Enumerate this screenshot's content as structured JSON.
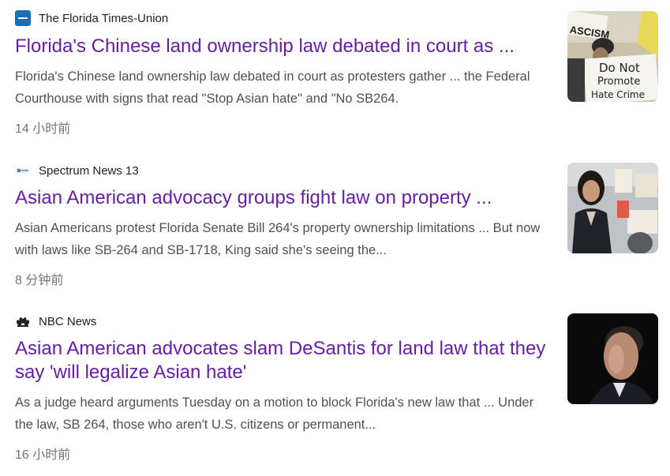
{
  "results": [
    {
      "source": "The Florida Times-Union",
      "source_icon": "times-union-logo-icon",
      "title": "Florida's Chinese land ownership law debated in court as ...",
      "snippet": "Florida's Chinese land ownership law debated in court as protesters gather ... the Federal Courthouse with signs that read \"Stop Asian hate\" and \"No SB264.",
      "time": "14 小时前",
      "thumbnail_signs": [
        "ASCISM",
        "Do Not",
        "Promote",
        "Hate Crime"
      ]
    },
    {
      "source": "Spectrum News 13",
      "source_icon": "spectrum-news-logo-icon",
      "title": "Asian American advocacy groups fight law on property ...",
      "snippet": "Asian Americans protest Florida Senate Bill 264's property ownership limitations ... But now with laws like SB-264 and SB-1718, King said she's seeing the...",
      "time": "8 分钟前"
    },
    {
      "source": "NBC News",
      "source_icon": "nbc-peacock-logo-icon",
      "title": "Asian American advocates slam DeSantis for land law that they say 'will legalize Asian hate'",
      "snippet": "As a judge heard arguments Tuesday on a motion to block Florida's new law that ... Under the law, SB 264, those who aren't U.S. citizens or permanent...",
      "time": "16 小时前"
    }
  ],
  "colors": {
    "title_visited": "#681da8",
    "snippet": "#4d5156",
    "time": "#70757a",
    "source": "#202124"
  }
}
